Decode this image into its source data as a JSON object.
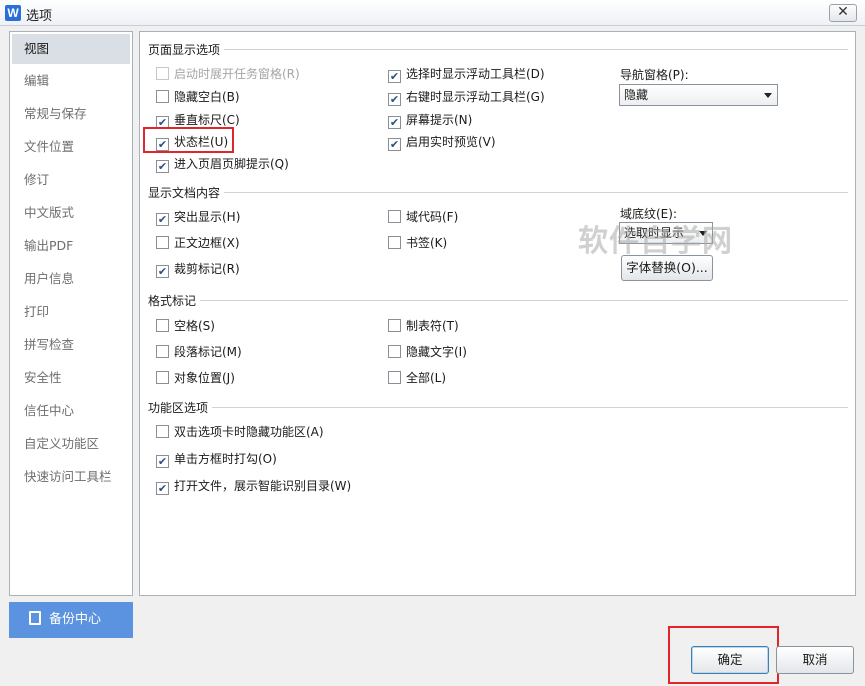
{
  "window": {
    "title": "选项",
    "app_icon": "W"
  },
  "sidebar": {
    "items": [
      {
        "label": "视图",
        "active": true
      },
      {
        "label": "编辑"
      },
      {
        "label": "常规与保存"
      },
      {
        "label": "文件位置"
      },
      {
        "label": "修订"
      },
      {
        "label": "中文版式"
      },
      {
        "label": "输出PDF"
      },
      {
        "label": "用户信息"
      },
      {
        "label": "打印"
      },
      {
        "label": "拼写检查"
      },
      {
        "label": "安全性"
      },
      {
        "label": "信任中心"
      },
      {
        "label": "自定义功能区"
      },
      {
        "label": "快速访问工具栏"
      }
    ],
    "backup_label": "备份中心"
  },
  "page_display": {
    "title": "页面显示选项",
    "options": [
      {
        "label": "启动时展开任务窗格(R)",
        "checked": false,
        "disabled": true
      },
      {
        "label": "隐藏空白(B)",
        "checked": false
      },
      {
        "label": "垂直标尺(C)",
        "checked": true
      },
      {
        "label": "状态栏(U)",
        "checked": true
      },
      {
        "label": "进入页眉页脚提示(Q)",
        "checked": true
      },
      {
        "label": "选择时显示浮动工具栏(D)",
        "checked": true
      },
      {
        "label": "右键时显示浮动工具栏(G)",
        "checked": true
      },
      {
        "label": "屏幕提示(N)",
        "checked": true
      },
      {
        "label": "启用实时预览(V)",
        "checked": true
      }
    ],
    "nav_pane_label": "导航窗格(P):",
    "nav_pane_value": "隐藏"
  },
  "doc_content": {
    "title": "显示文档内容",
    "options": [
      {
        "label": "突出显示(H)",
        "checked": true
      },
      {
        "label": "正文边框(X)",
        "checked": false
      },
      {
        "label": "裁剪标记(R)",
        "checked": true
      },
      {
        "label": "域代码(F)",
        "checked": false
      },
      {
        "label": "书签(K)",
        "checked": false
      }
    ],
    "field_shading_label": "域底纹(E):",
    "field_shading_value": "选取时显示",
    "font_replace_label": "字体替换(O)..."
  },
  "format_marks": {
    "title": "格式标记",
    "options": [
      {
        "label": "空格(S)",
        "checked": false
      },
      {
        "label": "段落标记(M)",
        "checked": false
      },
      {
        "label": "对象位置(J)",
        "checked": false
      },
      {
        "label": "制表符(T)",
        "checked": false
      },
      {
        "label": "隐藏文字(I)",
        "checked": false
      },
      {
        "label": "全部(L)",
        "checked": false
      }
    ]
  },
  "ribbon": {
    "title": "功能区选项",
    "options": [
      {
        "label": "双击选项卡时隐藏功能区(A)",
        "checked": false
      },
      {
        "label": "单击方框时打勾(O)",
        "checked": true
      },
      {
        "label": "打开文件，展示智能识别目录(W)",
        "checked": true
      }
    ]
  },
  "footer": {
    "ok_label": "确定",
    "cancel_label": "取消"
  },
  "watermark": "软件自学网",
  "colors": {
    "accent": "#5b93e0",
    "highlight": "#e0262d",
    "check": "#2a4f83"
  }
}
